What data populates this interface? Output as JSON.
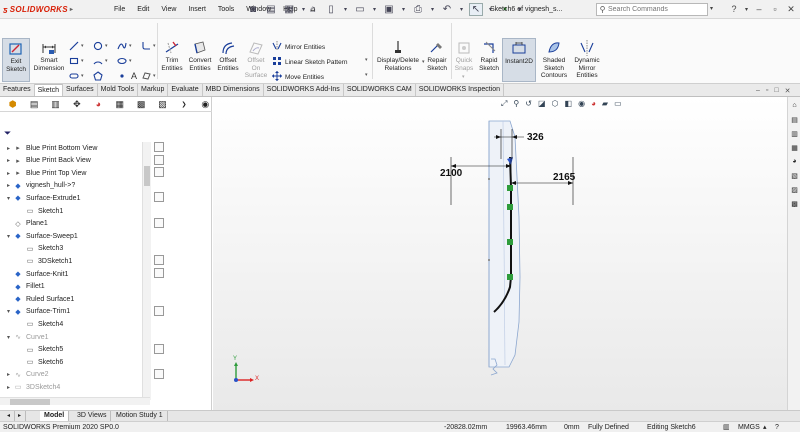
{
  "app": {
    "logo_text": "SOLIDWORKS",
    "menu": [
      "File",
      "Edit",
      "View",
      "Insert",
      "Tools",
      "Window",
      "Help"
    ],
    "doc_title": "Sketch6 of vignesh_s...",
    "search_placeholder": "Search Commands"
  },
  "ribbon": {
    "exit_sketch": "Exit\nSketch",
    "smart_dimension": "Smart\nDimension",
    "trim": "Trim\nEntities",
    "convert": "Convert\nEntities",
    "offset": "Offset\nEntities",
    "offset_surface": "Offset\nOn\nSurface",
    "mirror": "Mirror Entities",
    "linear_pattern": "Linear Sketch Pattern",
    "move": "Move Entities",
    "display_delete": "Display/Delete\nRelations",
    "repair": "Repair\nSketch",
    "quick_snaps": "Quick\nSnaps",
    "rapid_sketch": "Rapid\nSketch",
    "instant2d": "Instant2D",
    "shaded_contours": "Shaded\nSketch\nContours",
    "dynamic_mirror": "Dynamic\nMirror\nEntities"
  },
  "tabs": [
    "Features",
    "Sketch",
    "Surfaces",
    "Mold Tools",
    "Markup",
    "Evaluate",
    "MBD Dimensions",
    "SOLIDWORKS Add-Ins",
    "SOLIDWORKS CAM",
    "SOLIDWORKS Inspection"
  ],
  "active_tab": "Sketch",
  "tree": [
    {
      "label": "Blue Print Bottom View",
      "indent": 0,
      "arrow": "▸",
      "grey": false
    },
    {
      "label": "Blue Print Back View",
      "indent": 0,
      "arrow": "▸",
      "grey": false
    },
    {
      "label": "Blue Print Top View",
      "indent": 0,
      "arrow": "▸",
      "grey": false
    },
    {
      "label": "vignesh_hull->?",
      "indent": 0,
      "arrow": "▸",
      "grey": false
    },
    {
      "label": "Surface-Extrude1",
      "indent": 0,
      "arrow": "▾",
      "grey": false
    },
    {
      "label": "Sketch1",
      "indent": 1,
      "arrow": "",
      "grey": false
    },
    {
      "label": "Plane1",
      "indent": 0,
      "arrow": "",
      "grey": false
    },
    {
      "label": "Surface-Sweep1",
      "indent": 0,
      "arrow": "▾",
      "grey": false
    },
    {
      "label": "Sketch3",
      "indent": 1,
      "arrow": "",
      "grey": false
    },
    {
      "label": "3DSketch1",
      "indent": 1,
      "arrow": "",
      "grey": false
    },
    {
      "label": "Surface-Knit1",
      "indent": 0,
      "arrow": "",
      "grey": false
    },
    {
      "label": "Fillet1",
      "indent": 0,
      "arrow": "",
      "grey": false
    },
    {
      "label": "Ruled Surface1",
      "indent": 0,
      "arrow": "",
      "grey": false
    },
    {
      "label": "Surface-Trim1",
      "indent": 0,
      "arrow": "▾",
      "grey": false
    },
    {
      "label": "Sketch4",
      "indent": 1,
      "arrow": "",
      "grey": false
    },
    {
      "label": "Curve1",
      "indent": 0,
      "arrow": "▾",
      "grey": true
    },
    {
      "label": "Sketch5",
      "indent": 1,
      "arrow": "",
      "grey": false
    },
    {
      "label": "Sketch6",
      "indent": 1,
      "arrow": "",
      "grey": false
    },
    {
      "label": "Curve2",
      "indent": 0,
      "arrow": "▸",
      "grey": true
    },
    {
      "label": "3DSketch4",
      "indent": 0,
      "arrow": "▸",
      "grey": true
    }
  ],
  "dimensions": {
    "d1": "326",
    "d2": "2100",
    "d3": "2165"
  },
  "bottom_tabs": [
    "Model",
    "3D Views",
    "Motion Study 1"
  ],
  "status": {
    "product": "SOLIDWORKS Premium 2020 SP0.0",
    "x": "-20828.02mm",
    "y": "19963.46mm",
    "z": "0mm",
    "defined": "Fully Defined",
    "editing": "Editing Sketch6",
    "units": "MMGS"
  }
}
